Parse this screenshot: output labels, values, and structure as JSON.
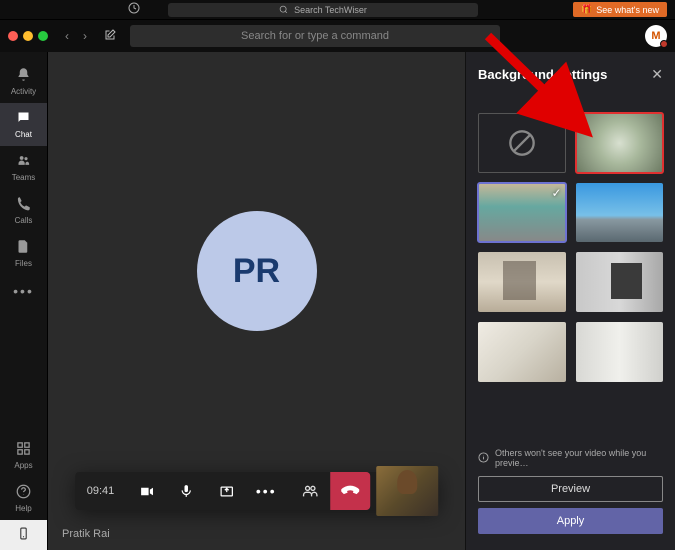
{
  "topbar": {
    "search_placeholder": "Search TechWiser",
    "whatsnew_label": "See what's new"
  },
  "cmdrow": {
    "search_placeholder": "Search for or type a command",
    "avatar_initial": "M"
  },
  "rail": {
    "items": [
      {
        "icon": "🔔",
        "label": "Activity"
      },
      {
        "icon": "💬",
        "label": "Chat"
      },
      {
        "icon": "👥",
        "label": "Teams"
      },
      {
        "icon": "📞",
        "label": "Calls"
      },
      {
        "icon": "📄",
        "label": "Files"
      }
    ],
    "apps_label": "Apps",
    "help_label": "Help"
  },
  "call": {
    "avatar_initials": "PR",
    "time": "09:41",
    "caller_name": "Pratik Rai"
  },
  "bg_panel": {
    "title": "Background settings",
    "info": "Others won't see your video while you previe…",
    "preview_label": "Preview",
    "apply_label": "Apply"
  }
}
